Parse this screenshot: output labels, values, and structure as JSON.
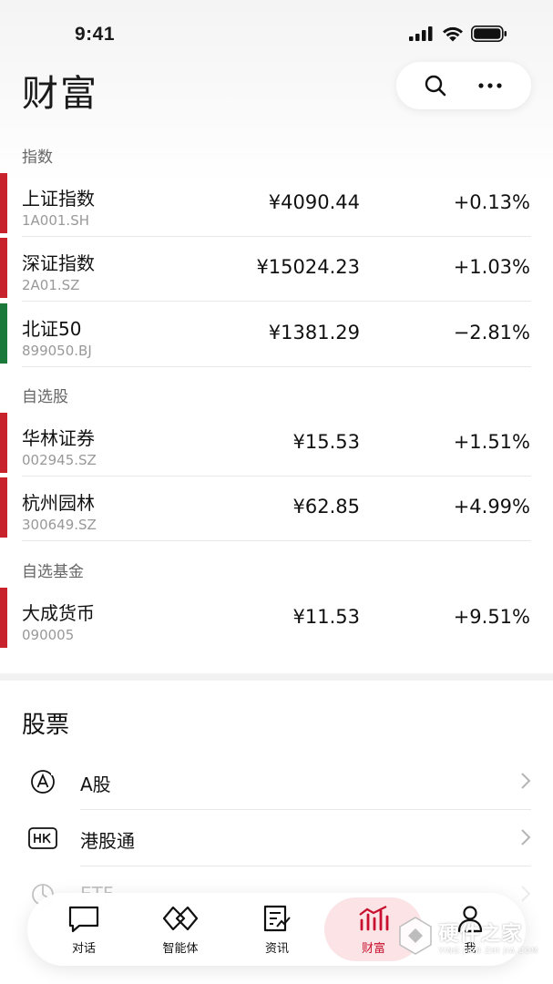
{
  "status_bar": {
    "time": "9:41"
  },
  "header": {
    "title": "财富",
    "icons": [
      "search-icon",
      "more-icon"
    ]
  },
  "sections": {
    "indices_label": "指数",
    "stocks_label": "自选股",
    "funds_label": "自选基金"
  },
  "indices": [
    {
      "name": "上证指数",
      "code": "1A001.SH",
      "price": "¥4090.44",
      "change": "+0.13%",
      "trend_color": "#c8232c"
    },
    {
      "name": "深证指数",
      "code": "2A01.SZ",
      "price": "¥15024.23",
      "change": "+1.03%",
      "trend_color": "#c8232c"
    },
    {
      "name": "北证50",
      "code": "899050.BJ",
      "price": "¥1381.29",
      "change": "−2.81%",
      "trend_color": "#1b7a3a"
    }
  ],
  "stocks": [
    {
      "name": "华林证券",
      "code": "002945.SZ",
      "price": "¥15.53",
      "change": "+1.51%",
      "trend_color": "#c8232c"
    },
    {
      "name": "杭州园林",
      "code": "300649.SZ",
      "price": "¥62.85",
      "change": "+4.99%",
      "trend_color": "#c8232c"
    }
  ],
  "funds": [
    {
      "name": "大成货币",
      "code": "090005",
      "price": "¥11.53",
      "change": "+9.51%",
      "trend_color": "#c8232c"
    }
  ],
  "stock_section": {
    "title": "股票",
    "items": [
      {
        "label": "A股",
        "icon": "a-share-icon"
      },
      {
        "label": "港股通",
        "icon": "hk-icon"
      },
      {
        "label": "ETF",
        "icon": "etf-icon"
      }
    ]
  },
  "tabbar": {
    "items": [
      {
        "label": "对话",
        "icon": "chat-icon"
      },
      {
        "label": "智能体",
        "icon": "agent-icon"
      },
      {
        "label": "资讯",
        "icon": "news-icon"
      },
      {
        "label": "财富",
        "icon": "wealth-icon",
        "active": true
      },
      {
        "label": "我",
        "icon": "profile-icon"
      }
    ],
    "active_color": "#c8102e"
  },
  "watermark": {
    "text": "硬件之家",
    "sub": "YING JIAN ZHI JIA.COM"
  }
}
